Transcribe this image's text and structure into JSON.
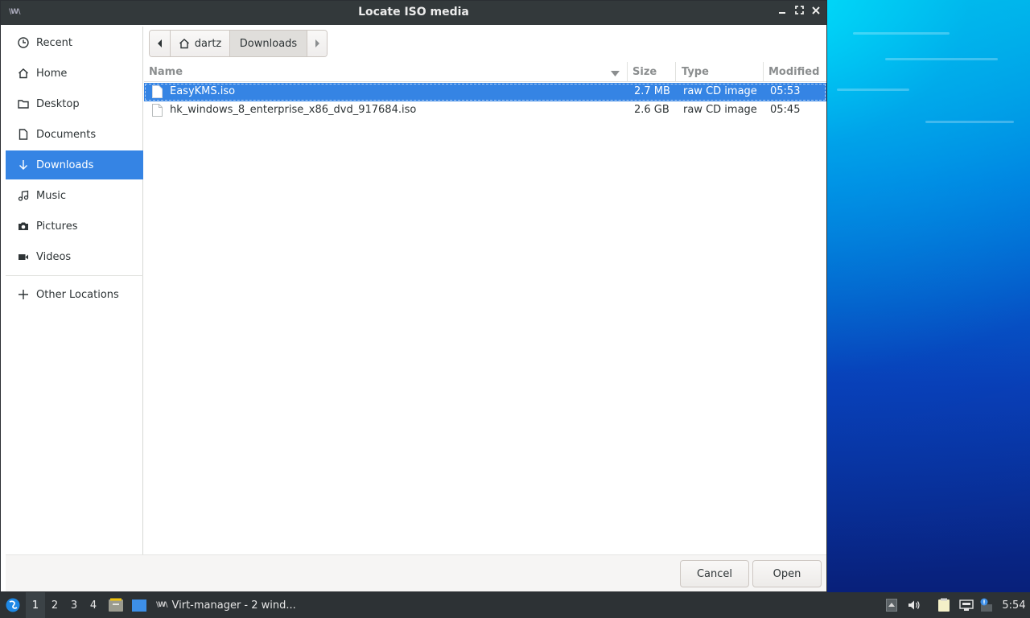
{
  "window": {
    "title": "Locate ISO media",
    "app_icon_text": "\\W\\"
  },
  "sidebar": {
    "items": [
      {
        "label": "Recent",
        "icon": "clock-icon"
      },
      {
        "label": "Home",
        "icon": "home-icon"
      },
      {
        "label": "Desktop",
        "icon": "folder-icon"
      },
      {
        "label": "Documents",
        "icon": "document-icon"
      },
      {
        "label": "Downloads",
        "icon": "download-icon",
        "active": true
      },
      {
        "label": "Music",
        "icon": "music-icon"
      },
      {
        "label": "Pictures",
        "icon": "camera-icon"
      },
      {
        "label": "Videos",
        "icon": "video-icon"
      },
      {
        "label": "Other Locations",
        "icon": "plus-icon"
      }
    ]
  },
  "pathbar": {
    "home": "dartz",
    "current": "Downloads"
  },
  "filelist": {
    "columns": {
      "name": "Name",
      "size": "Size",
      "type": "Type",
      "modified": "Modified"
    },
    "rows": [
      {
        "name": "EasyKMS.iso",
        "size": "2.7 MB",
        "type": "raw CD image",
        "modified": "05:53",
        "selected": true
      },
      {
        "name": "hk_windows_8_enterprise_x86_dvd_917684.iso",
        "size": "2.6 GB",
        "type": "raw CD image",
        "modified": "05:45",
        "selected": false
      }
    ]
  },
  "footer": {
    "cancel_label": "Cancel",
    "open_label": "Open"
  },
  "taskbar": {
    "workspaces": [
      "1",
      "2",
      "3",
      "4"
    ],
    "active_workspace": "1",
    "task_label": "Virt-manager - 2 wind...",
    "clock": "5:54"
  },
  "colors": {
    "accent": "#3584e4",
    "titlebar": "#33393b",
    "taskbar": "#2d3235"
  }
}
